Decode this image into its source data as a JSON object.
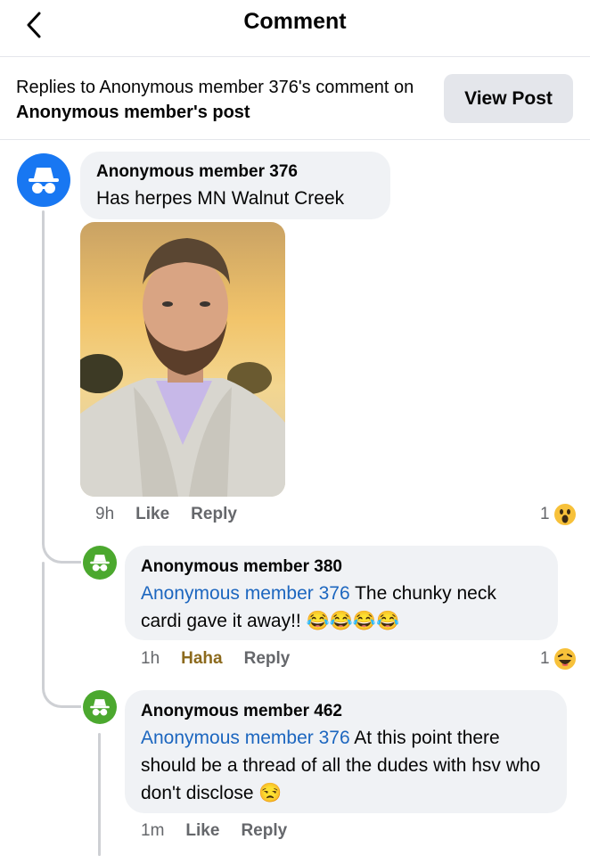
{
  "header": {
    "title": "Comment",
    "back_icon": "chevron-left-icon"
  },
  "context": {
    "line_prefix": "Replies to Anonymous member 376's comment on ",
    "post_owner": "Anonymous member",
    "line_suffix": "'s post",
    "view_post_label": "View Post"
  },
  "main_comment": {
    "author": "Anonymous member 376",
    "text": "Has herpes MN Walnut Creek",
    "time": "9h",
    "like_label": "Like",
    "reply_label": "Reply",
    "reaction_count": "1",
    "reaction_icon": "wow-reaction-icon",
    "avatar_icon": "anonymous-incognito-icon"
  },
  "replies": [
    {
      "author": "Anonymous member 380",
      "mention": "Anonymous member 376",
      "text": " The chunky neck cardi gave it away!! ",
      "emojis": "😂😂😂😂",
      "time": "1h",
      "reaction_label": "Haha",
      "reply_label": "Reply",
      "reaction_count": "1",
      "reaction_icon": "haha-reaction-icon"
    },
    {
      "author": "Anonymous member 462",
      "mention": "Anonymous member 376",
      "text": " At this point there should be a thread of all the dudes with hsv who don't disclose ",
      "emojis": "😒",
      "time": "1m",
      "like_label": "Like",
      "reply_label": "Reply"
    }
  ],
  "colors": {
    "accent": "#1877f2",
    "mention": "#1c66bf",
    "anon_green": "#4ba82e",
    "bubble": "#f0f2f5"
  }
}
